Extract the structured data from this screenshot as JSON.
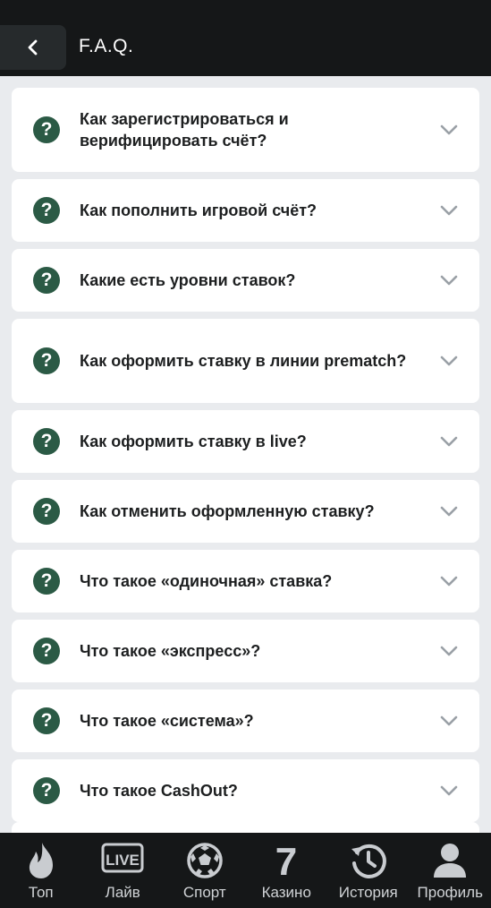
{
  "header": {
    "title": "F.A.Q."
  },
  "faq_items": [
    {
      "question": "Как зарегистрироваться и верифицировать счёт?"
    },
    {
      "question": "Как пополнить игровой счёт?"
    },
    {
      "question": "Какие есть уровни ставок?"
    },
    {
      "question": "Как оформить ставку в линии prematch?"
    },
    {
      "question": "Как оформить ставку в live?"
    },
    {
      "question": "Как отменить оформленную ставку?"
    },
    {
      "question": "Что такое «одиночная» ставка?"
    },
    {
      "question": "Что такое «экспресс»?"
    },
    {
      "question": "Что такое «система»?"
    },
    {
      "question": "Что такое CashOut?"
    }
  ],
  "question_mark": "?",
  "bottom_nav": [
    {
      "label": "Топ",
      "icon": "flame-icon"
    },
    {
      "label": "Лайв",
      "icon": "live-icon",
      "badge": "LIVE"
    },
    {
      "label": "Спорт",
      "icon": "soccer-ball-icon"
    },
    {
      "label": "Казино",
      "icon": "seven-icon",
      "badge": "7"
    },
    {
      "label": "История",
      "icon": "history-icon"
    },
    {
      "label": "Профиль",
      "icon": "profile-icon"
    }
  ],
  "colors": {
    "header_bg": "#151718",
    "accent_green": "#2b5a45",
    "page_bg": "#e9ebee",
    "card_bg": "#ffffff",
    "nav_icon": "#c9ccd0"
  }
}
